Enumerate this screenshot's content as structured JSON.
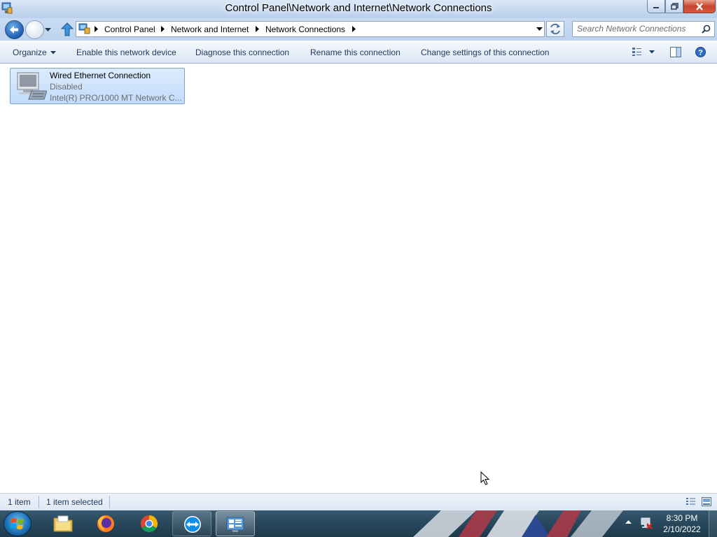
{
  "window": {
    "title": "Control Panel\\Network and Internet\\Network Connections"
  },
  "address": {
    "breadcrumbs": [
      "Control Panel",
      "Network and Internet",
      "Network Connections"
    ]
  },
  "search": {
    "placeholder": "Search Network Connections"
  },
  "toolbar": {
    "organize": "Organize",
    "enable_device": "Enable this network device",
    "diagnose": "Diagnose this connection",
    "rename": "Rename this connection",
    "change_settings": "Change settings of this connection"
  },
  "connection": {
    "name": "Wired Ethernet Connection",
    "status": "Disabled",
    "device": "Intel(R) PRO/1000 MT Network C..."
  },
  "statusbar": {
    "item_count": "1 item",
    "selected_count": "1 item selected"
  },
  "taskbar": {
    "apps": [
      "windows-explorer",
      "firefox",
      "chrome",
      "teamviewer",
      "network-connections"
    ],
    "time": "8:30 PM",
    "date": "2/10/2022"
  },
  "colors": {
    "title_bar": "#c9dcf2",
    "selection": "#cce3fc",
    "text_link": "#1e395b"
  }
}
